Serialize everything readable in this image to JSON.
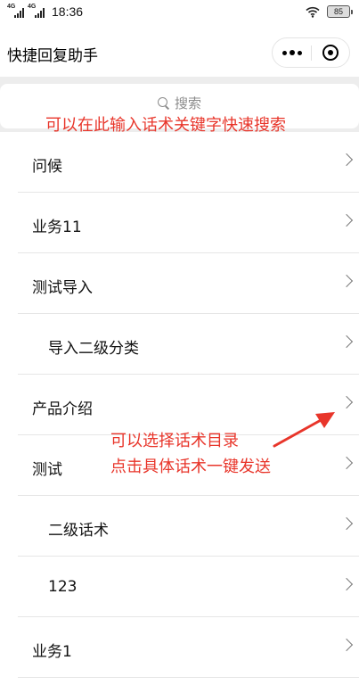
{
  "status_bar": {
    "signal_1": "4G",
    "signal_2": "4G",
    "time": "18:36",
    "battery": "85"
  },
  "nav": {
    "title": "快捷回复助手"
  },
  "search": {
    "placeholder": "搜索"
  },
  "list": [
    {
      "label": "问候",
      "level": 1
    },
    {
      "label": "业务11",
      "level": 1
    },
    {
      "label": "测试导入",
      "level": 1
    },
    {
      "label": "导入二级分类",
      "level": 2
    },
    {
      "label": "产品介绍",
      "level": 1
    },
    {
      "label": "测试",
      "level": 1
    },
    {
      "label": "二级话术",
      "level": 2
    },
    {
      "label": "123",
      "level": 2
    },
    {
      "label": "业务1",
      "level": 1
    }
  ],
  "annotations": {
    "search_hint": "可以在此输入话术关键字快速搜索",
    "select_hint_1": "可以选择话术目录",
    "select_hint_2": "点击具体话术一键发送",
    "color": "#e8352a"
  }
}
